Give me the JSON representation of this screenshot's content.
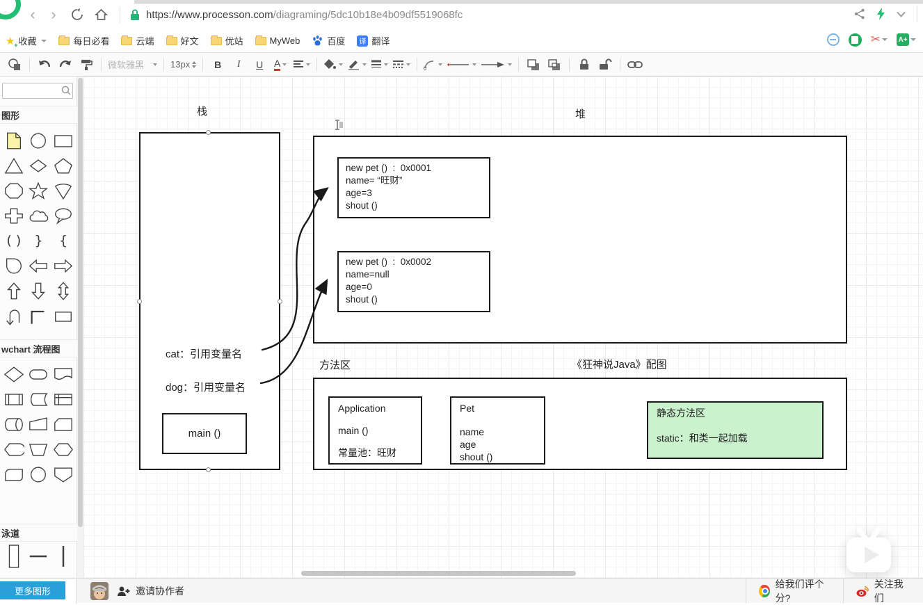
{
  "colors": {
    "accent_green": "#21bf73",
    "button_blue": "#2b9fd9",
    "static_area_fill": "#c9f2cd",
    "note_yellow": "#fbf3a7"
  },
  "icons": {
    "back-icon": "‹",
    "forward-icon": "›",
    "refresh-icon": "circular-arrow",
    "home-icon": "house",
    "lock-icon": "green-padlock",
    "share-icon": "share-nodes",
    "lightning-icon": "green-bolt",
    "search-icon": "magnifier",
    "scissors-icon": "✂",
    "translate-badge": "译"
  },
  "browser": {
    "url_host": "https://www.processon.com",
    "url_path": "/diagraming/5dc10b18e4b09df5519068fc",
    "bookmarks_root": "收藏",
    "bookmarks": [
      "每日必看",
      "云端",
      "好文",
      "优站",
      "MyWeb"
    ],
    "baidu_label": "百度",
    "translate_label": "翻译"
  },
  "toolbar": {
    "font_name": "微软雅黑",
    "font_size": "13px",
    "bold": "B",
    "italic": "I",
    "underline": "U",
    "font_color": "A"
  },
  "sidebar": {
    "section_basic": "图形",
    "section_flowchart": "wchart 流程图",
    "section_swimlane": "泳道",
    "more_shapes": "更多图形"
  },
  "canvas": {
    "stack_label": "栈",
    "heap_label": "堆",
    "method_area_label": "方法区",
    "caption": "《狂神说Java》配图",
    "stack": {
      "cat": "cat：引用变量名",
      "dog": "dog：引用变量名",
      "main": "main ()"
    },
    "heap_obj1": [
      "new pet ()  :  0x0001",
      "name= “旺财”",
      "age=3",
      "shout ()"
    ],
    "heap_obj2": [
      "new pet ()  :  0x0002",
      "name=null",
      "age=0",
      "shout ()"
    ],
    "app_class": [
      "Application",
      "main ()",
      "常量池：旺财"
    ],
    "pet_class": [
      "Pet",
      "name",
      "age",
      "shout ()"
    ],
    "static_area": [
      "静态方法区",
      "static：和类一起加载"
    ]
  },
  "statusbar": {
    "invite": "邀请协作者",
    "rate": "给我们评个分?",
    "follow": "关注我们"
  }
}
